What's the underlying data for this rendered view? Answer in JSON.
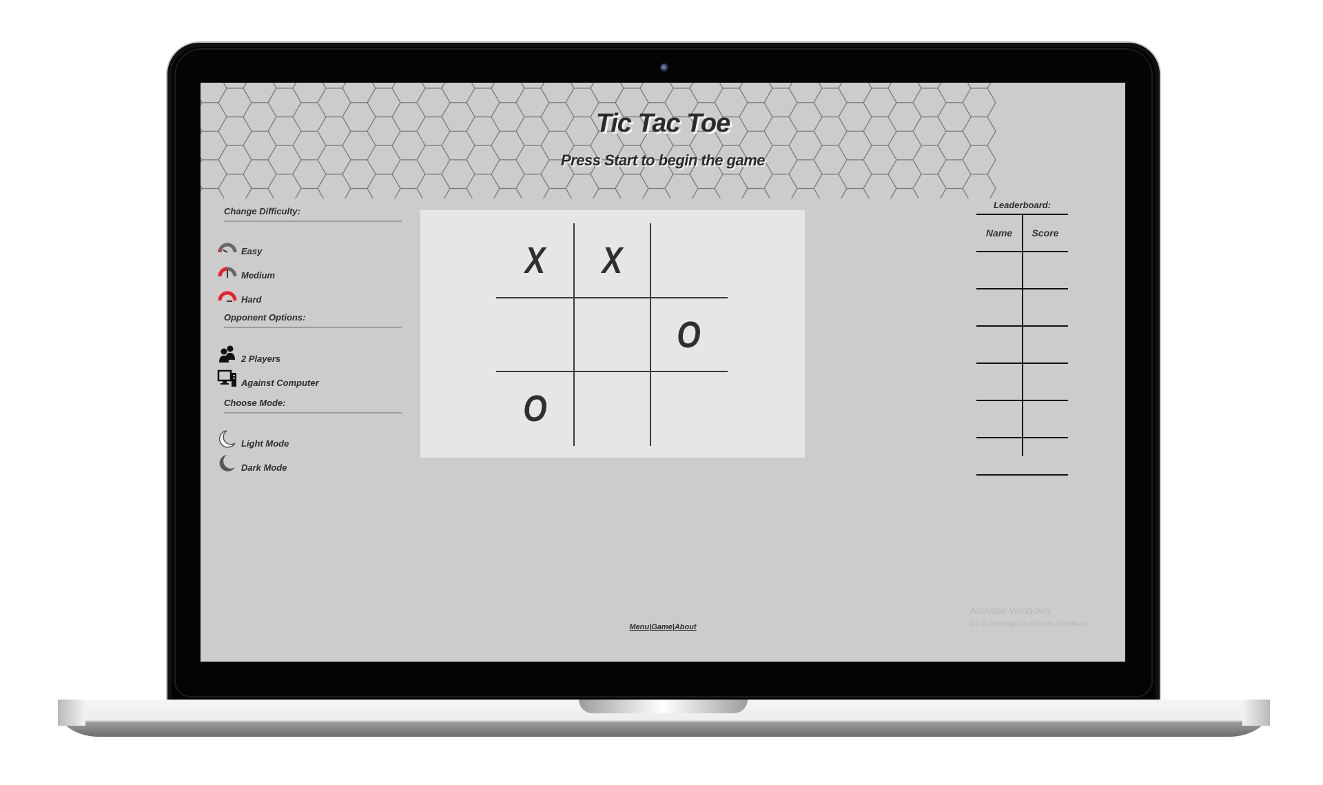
{
  "app": {
    "title": "Tic Tac Toe",
    "subtitle": "Press Start to begin the game"
  },
  "sidebar": {
    "difficulty": {
      "heading": "Change Difficulty:",
      "items": [
        {
          "label": "Easy",
          "icon": "gauge-low-icon"
        },
        {
          "label": "Medium",
          "icon": "gauge-medium-icon"
        },
        {
          "label": "Hard",
          "icon": "gauge-high-icon"
        }
      ]
    },
    "opponent": {
      "heading": "Opponent Options:",
      "items": [
        {
          "label": "2 Players",
          "icon": "two-users-icon"
        },
        {
          "label": "Against Computer",
          "icon": "desktop-computer-icon"
        }
      ]
    },
    "mode": {
      "heading": "Choose Mode:",
      "items": [
        {
          "label": "Light Mode",
          "icon": "moon-light-icon"
        },
        {
          "label": "Dark Mode",
          "icon": "moon-dark-icon"
        }
      ]
    }
  },
  "board": {
    "cells": [
      "X",
      "X",
      "",
      "",
      "",
      "O",
      "O",
      "",
      ""
    ]
  },
  "leaderboard": {
    "title": "Leaderboard:",
    "columns": [
      "Name",
      "Score"
    ],
    "rows": [
      {
        "name": "",
        "score": ""
      },
      {
        "name": "",
        "score": ""
      },
      {
        "name": "",
        "score": ""
      },
      {
        "name": "",
        "score": ""
      },
      {
        "name": "",
        "score": ""
      },
      {
        "name": "",
        "score": ""
      }
    ]
  },
  "footer": {
    "links": [
      "Menu",
      "Game",
      "About"
    ],
    "separator": "|"
  },
  "watermark": {
    "line1": "Activate Windows",
    "line2": "Go to Settings to activate Windows."
  },
  "colors": {
    "accent_red": "#e8202a",
    "gauge_gray": "#666666",
    "page_bg": "#cccccc",
    "board_bg": "#e6e6e6",
    "text": "#2e2e2e"
  }
}
